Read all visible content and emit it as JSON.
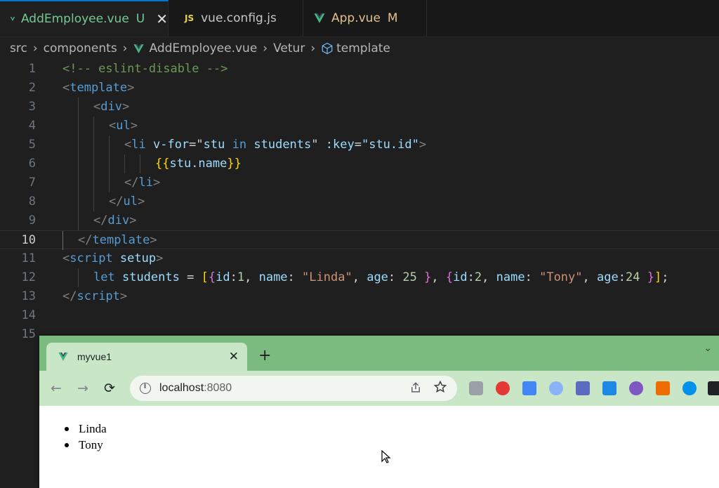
{
  "tabs": [
    {
      "name": "AddEmployee.vue",
      "badge": "U",
      "close": "✕"
    },
    {
      "icon": "JS",
      "name": "vue.config.js"
    },
    {
      "name": "App.vue",
      "badge": "M"
    }
  ],
  "breadcrumb": {
    "src": "src",
    "components": "components",
    "file": "AddEmployee.vue",
    "vetur": "Vetur",
    "template": "template",
    "sep": "›"
  },
  "editor": {
    "line_numbers": [
      "1",
      "2",
      "3",
      "4",
      "5",
      "6",
      "7",
      "8",
      "9",
      "10",
      "11",
      "12",
      "13",
      "14",
      "15"
    ],
    "current_line": "10",
    "code": {
      "l1_comment": "<!-- eslint-disable -->",
      "l2_open": "<",
      "l2_tag": "template",
      "l2_close": ">",
      "l3_open": "<",
      "l3_tag": "div",
      "l3_close": ">",
      "l4_open": "<",
      "l4_tag": "ul",
      "l4_close": ">",
      "l5_open": "<",
      "l5_tag": "li",
      "l5_vfor": "v-for",
      "l5_eq1": "=",
      "l5_q1": "\"",
      "l5_stu": "stu",
      "l5_in": "in",
      "l5_students": "students",
      "l5_q2": "\"",
      "l5_key": ":key",
      "l5_eq2": "=",
      "l5_keyval": "\"stu.id\"",
      "l5_close": ">",
      "l6_open": "{{",
      "l6_expr": "stu.name",
      "l6_close": "}}",
      "l7_open": "</",
      "l7_tag": "li",
      "l7_close": ">",
      "l8_open": "</",
      "l8_tag": "ul",
      "l8_close": ">",
      "l9_open": "</",
      "l9_tag": "div",
      "l9_close": ">",
      "l10_open": "</",
      "l10_tag": "template",
      "l10_close": ">",
      "l11_open": "<",
      "l11_tag": "script",
      "l11_attr": "setup",
      "l11_close": ">",
      "l12_let": "let",
      "l12_var": "students",
      "l12_eq": "=",
      "l12_b1": "[",
      "l12_b2a": "{",
      "l12_id1k": "id",
      "l12_c1": ":",
      "l12_id1v": "1",
      "l12_comma1": ",",
      "l12_name1k": "name",
      "l12_c2": ":",
      "l12_name1v": "\"Linda\"",
      "l12_comma2": ",",
      "l12_age1k": "age",
      "l12_c3": ":",
      "l12_age1v": "25",
      "l12_b2a_close": "}",
      "l12_comma3": ",",
      "l12_b2b": "{",
      "l12_id2k": "id",
      "l12_c4": ":",
      "l12_id2v": "2",
      "l12_comma4": ",",
      "l12_name2k": "name",
      "l12_c5": ":",
      "l12_name2v": "\"Tony\"",
      "l12_comma5": ",",
      "l12_age2k": "age",
      "l12_c6": ":",
      "l12_age2v": "24",
      "l12_b2b_close": "}",
      "l12_b1_close": "]",
      "l12_semi": ";",
      "l13_open": "</",
      "l13_tag": "script",
      "l13_close": ">"
    }
  },
  "browser": {
    "tab_title": "myvue1",
    "tab_close": "✕",
    "new_tab": "+",
    "tabs_menu": "⌄",
    "url_host": "localhost",
    "url_port": ":8080",
    "nav": {
      "back": "←",
      "forward": "→",
      "reload": "⟳"
    },
    "page_items": [
      "Linda",
      "Tony"
    ]
  },
  "colors": {
    "accent": "#0078d4",
    "browser_frame": "#7cbb7f",
    "browser_toolbar": "#c9e6c7"
  }
}
